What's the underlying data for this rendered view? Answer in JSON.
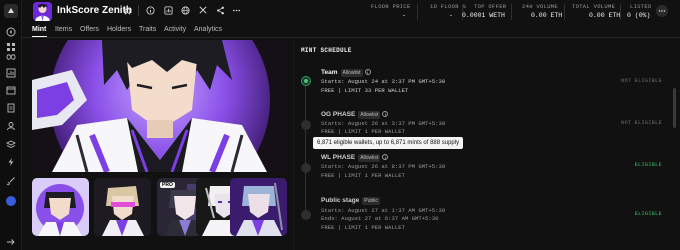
{
  "collection": {
    "title": "InkScore Zenith"
  },
  "sidebar": {
    "icons": [
      "logo-icon",
      "compass-icon",
      "grid-icon",
      "infinity-icon",
      "chart-icon",
      "calendar-icon",
      "document-icon",
      "users-icon",
      "stack-icon",
      "lightning-icon",
      "brush-icon",
      "profile-icon",
      "arrow-right-icon"
    ]
  },
  "header_icons": [
    "star-icon",
    "info-icon",
    "globe-icon",
    "x-icon",
    "share-icon",
    "more-icon"
  ],
  "stats": [
    {
      "label": "FLOOR PRICE",
      "value": "-"
    },
    {
      "label": "1D FLOOR %",
      "value": "-"
    },
    {
      "label": "TOP OFFER",
      "value": "0.0001 WETH"
    },
    {
      "label": "24H VOLUME",
      "value": "0.00 ETH"
    },
    {
      "label": "TOTAL VOLUME",
      "value": "0.00 ETH"
    },
    {
      "label": "LISTED",
      "value": "0 (0%)"
    }
  ],
  "tabs": [
    "Mint",
    "Items",
    "Offers",
    "Holders",
    "Traits",
    "Activity",
    "Analytics"
  ],
  "thumbnails": [
    {
      "name": "thumb-1"
    },
    {
      "name": "thumb-2"
    },
    {
      "name": "thumb-3",
      "badge": "PRO"
    },
    {
      "name": "thumb-4"
    },
    {
      "name": "thumb-5"
    }
  ],
  "schedule": {
    "title": "MINT SCHEDULE",
    "phases": [
      {
        "name": "Team",
        "tag": "Allowlist",
        "starts": "Starts: August 24 at 3:37 PM GMT+5:30",
        "limit": "FREE | LIMIT 33 PER WALLET",
        "eligibility": "NOT ELIGIBLE",
        "eligible": false,
        "active": true
      },
      {
        "name": "OG PHASE",
        "tag": "Allowlist",
        "starts": "Starts: August 26 at 3:37 PM GMT+5:30",
        "limit": "FREE | LIMIT 1 PER WALLET",
        "eligibility": "NOT ELIGIBLE",
        "eligible": false,
        "active": false
      },
      {
        "name": "WL PHASE",
        "tag": "Allowlist",
        "starts": "Starts: August 26 at 8:37 PM GMT+5:30",
        "limit": "FREE | LIMIT 1 PER WALLET",
        "eligibility": "ELIGIBLE",
        "eligible": true,
        "active": false
      },
      {
        "name": "Public stage",
        "tag": "Public",
        "starts": "Starts: August 27 at 1:37 AM GMT+5:30",
        "ends": "Ends: August 27 at 6:37 AM GMT+5:30",
        "limit": "FREE | LIMIT 1 PER WALLET",
        "eligibility": "ELIGIBLE",
        "eligible": true,
        "active": false
      }
    ],
    "tooltip": "6,871 eligible wallets, up to 6,871 mints of 888 supply"
  },
  "colors": {
    "background": "#111111",
    "accent_purple": "#7b3fe4",
    "eligible_green": "#3fbf6b",
    "muted": "#9a9a9a"
  }
}
